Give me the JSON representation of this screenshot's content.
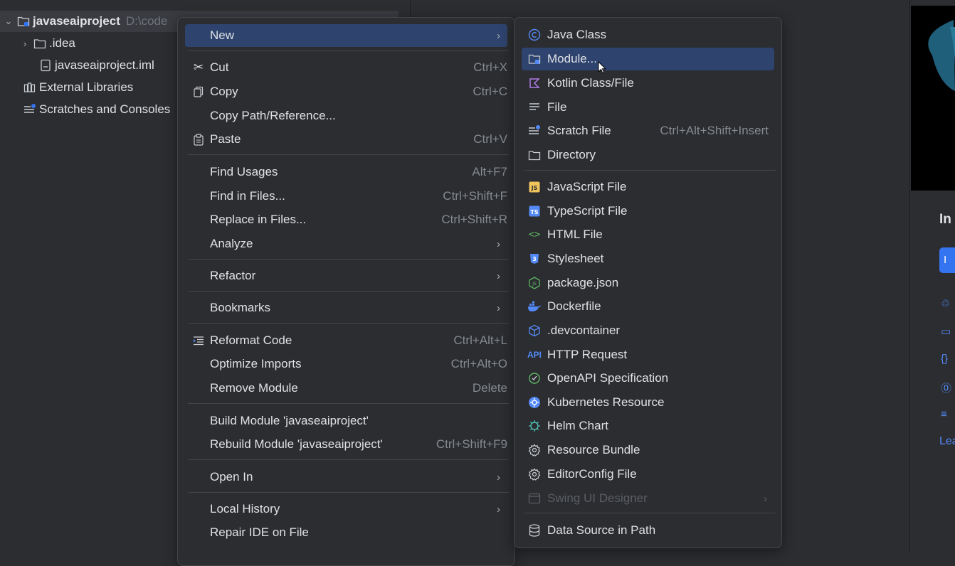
{
  "project_tree": {
    "root": {
      "label": "javaseaiproject",
      "path": "D:\\code"
    },
    "items": [
      {
        "label": ".idea"
      },
      {
        "label": "javaseaiproject.iml"
      },
      {
        "label": "External Libraries"
      },
      {
        "label": "Scratches and Consoles"
      }
    ]
  },
  "context_menu": {
    "items": [
      {
        "label": "New",
        "shortcut": ""
      },
      {
        "label": "Cut",
        "shortcut": "Ctrl+X"
      },
      {
        "label": "Copy",
        "shortcut": "Ctrl+C"
      },
      {
        "label": "Copy Path/Reference...",
        "shortcut": ""
      },
      {
        "label": "Paste",
        "shortcut": "Ctrl+V"
      },
      {
        "label": "Find Usages",
        "shortcut": "Alt+F7"
      },
      {
        "label": "Find in Files...",
        "shortcut": "Ctrl+Shift+F"
      },
      {
        "label": "Replace in Files...",
        "shortcut": "Ctrl+Shift+R"
      },
      {
        "label": "Analyze",
        "shortcut": ""
      },
      {
        "label": "Refactor",
        "shortcut": ""
      },
      {
        "label": "Bookmarks",
        "shortcut": ""
      },
      {
        "label": "Reformat Code",
        "shortcut": "Ctrl+Alt+L"
      },
      {
        "label": "Optimize Imports",
        "shortcut": "Ctrl+Alt+O"
      },
      {
        "label": "Remove Module",
        "shortcut": "Delete"
      },
      {
        "label": "Build Module 'javaseaiproject'",
        "shortcut": ""
      },
      {
        "label": "Rebuild Module 'javaseaiproject'",
        "shortcut": "Ctrl+Shift+F9"
      },
      {
        "label": "Open In",
        "shortcut": ""
      },
      {
        "label": "Local History",
        "shortcut": ""
      },
      {
        "label": "Repair IDE on File",
        "shortcut": ""
      }
    ]
  },
  "new_submenu": {
    "items": [
      {
        "label": "Java Class",
        "shortcut": ""
      },
      {
        "label": "Module...",
        "shortcut": ""
      },
      {
        "label": "Kotlin Class/File",
        "shortcut": ""
      },
      {
        "label": "File",
        "shortcut": ""
      },
      {
        "label": "Scratch File",
        "shortcut": "Ctrl+Alt+Shift+Insert"
      },
      {
        "label": "Directory",
        "shortcut": ""
      },
      {
        "label": "JavaScript File",
        "shortcut": ""
      },
      {
        "label": "TypeScript File",
        "shortcut": ""
      },
      {
        "label": "HTML File",
        "shortcut": ""
      },
      {
        "label": "Stylesheet",
        "shortcut": ""
      },
      {
        "label": "package.json",
        "shortcut": ""
      },
      {
        "label": "Dockerfile",
        "shortcut": ""
      },
      {
        "label": ".devcontainer",
        "shortcut": ""
      },
      {
        "label": "HTTP Request",
        "shortcut": ""
      },
      {
        "label": "OpenAPI Specification",
        "shortcut": ""
      },
      {
        "label": "Kubernetes Resource",
        "shortcut": ""
      },
      {
        "label": "Helm Chart",
        "shortcut": ""
      },
      {
        "label": "Resource Bundle",
        "shortcut": ""
      },
      {
        "label": "EditorConfig File",
        "shortcut": ""
      },
      {
        "label": "Swing UI Designer",
        "shortcut": ""
      },
      {
        "label": "Data Source in Path",
        "shortcut": ""
      }
    ]
  },
  "right_panel": {
    "heading": "In",
    "button_label": "I",
    "link": "Lea"
  },
  "colors": {
    "background": "#2b2d30",
    "highlight": "#2e436e",
    "accent": "#3574f0",
    "text": "#dfe1e5",
    "shortcut_text": "#868a91"
  }
}
